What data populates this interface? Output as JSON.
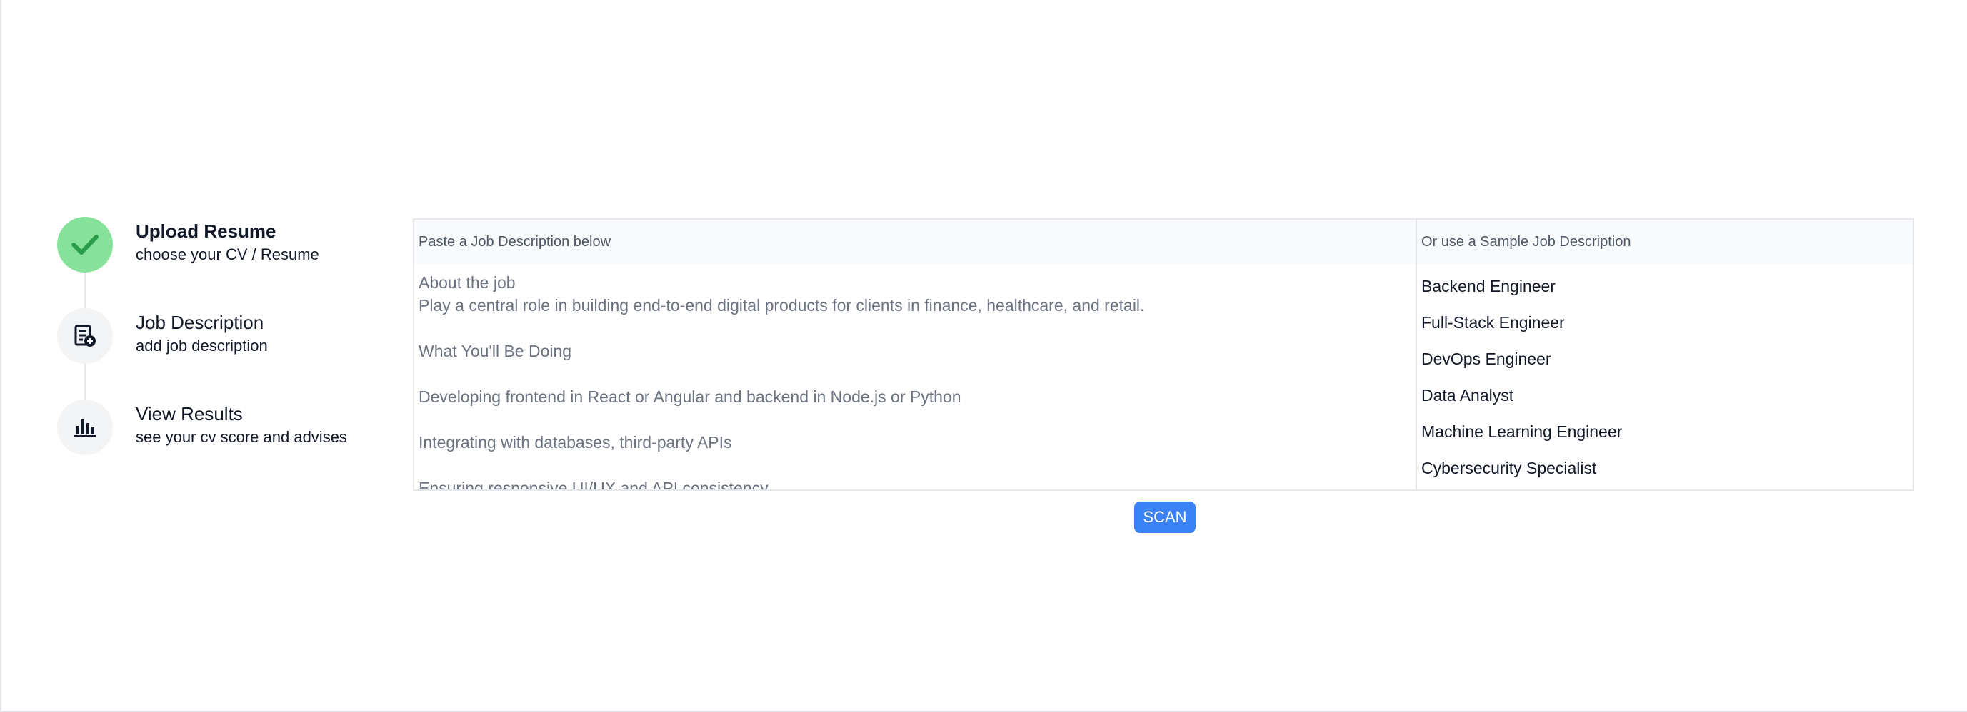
{
  "stepper": {
    "steps": [
      {
        "title": "Upload Resume",
        "subtitle": "choose your CV / Resume",
        "icon": "check-icon",
        "status": "completed"
      },
      {
        "title": "Job Description",
        "subtitle": "add job description",
        "icon": "document-add-icon",
        "status": "current"
      },
      {
        "title": "View Results",
        "subtitle": "see your cv score and advises",
        "icon": "bar-chart-icon",
        "status": "pending"
      }
    ]
  },
  "job_panel": {
    "paste_header": "Paste a Job Description below",
    "sample_header": "Or use a Sample Job Description",
    "job_description_text": "About the job\nPlay a central role in building end-to-end digital products for clients in finance, healthcare, and retail.\n\nWhat You'll Be Doing\n\nDeveloping frontend in React or Angular and backend in Node.js or Python\n\nIntegrating with databases, third-party APIs\n\nEnsuring responsive UI/UX and API consistency",
    "samples": [
      "Backend Engineer",
      "Full-Stack Engineer",
      "DevOps Engineer",
      "Data Analyst",
      "Machine Learning Engineer",
      "Cybersecurity Specialist"
    ]
  },
  "scan_button": {
    "label": "SCAN"
  },
  "colors": {
    "accent": "#3b82f6",
    "success": "#86e29b",
    "success_check": "#22a34a",
    "muted_text": "#6b7280"
  }
}
